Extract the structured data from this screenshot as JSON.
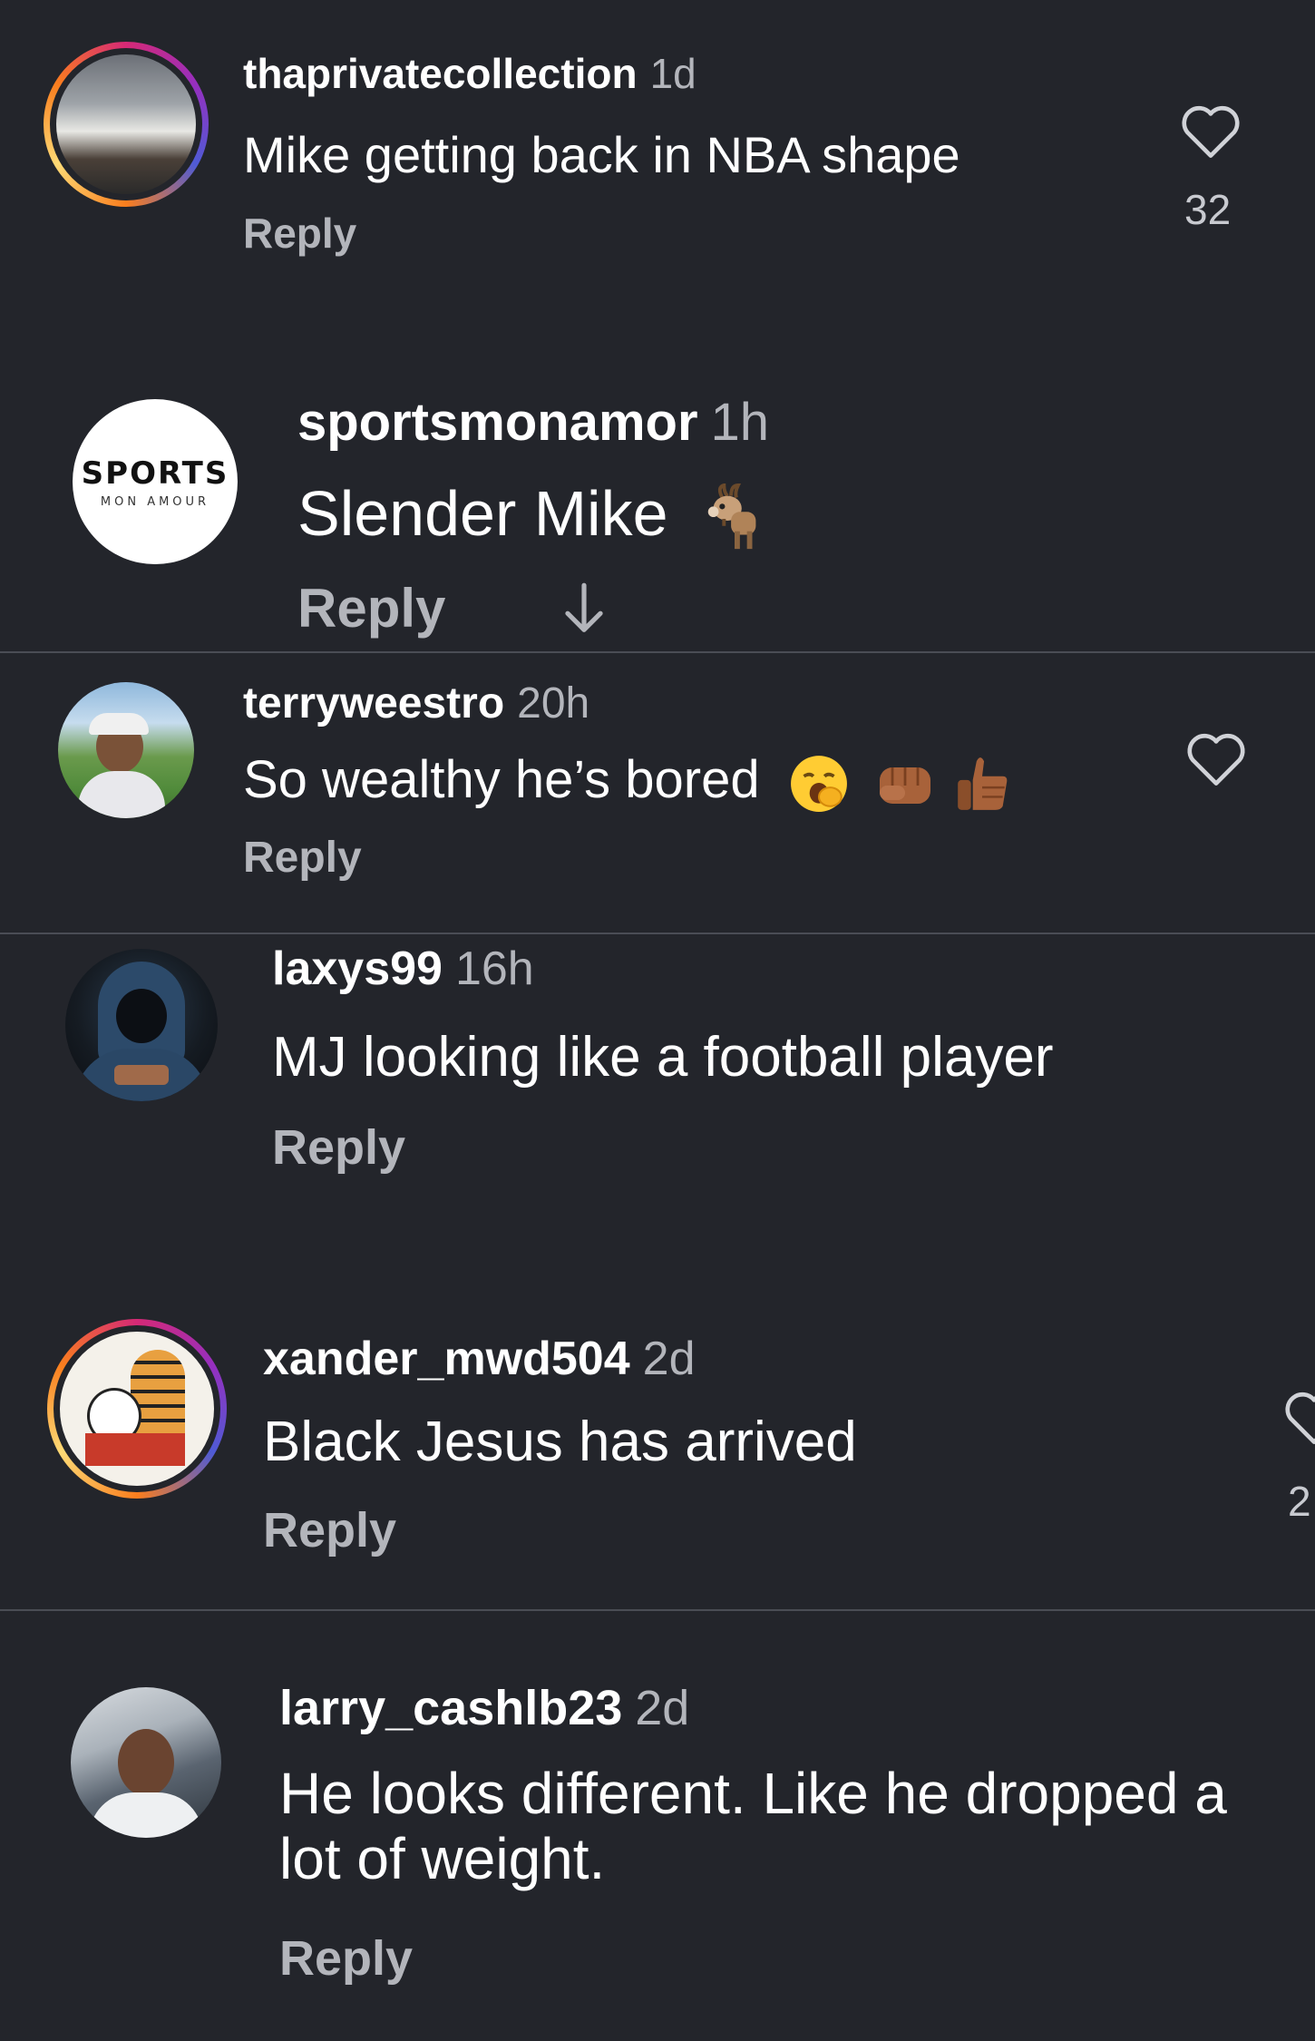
{
  "comments": [
    {
      "username": "thaprivatecollection",
      "time": "1d",
      "text": "Mike getting back in NBA shape",
      "reply": "Reply",
      "likes": "32",
      "avatar_icon": "avatar-photo-car"
    },
    {
      "username": "sportsmonamor",
      "time": "1h",
      "text": "Slender Mike",
      "reply": "Reply",
      "avatar_logo_big": "SPORTS",
      "avatar_logo_small": "MON AMOUR",
      "emoji": "goat-emoji",
      "extra_icon": "arrow-down-icon"
    },
    {
      "username": "terryweestro",
      "time": "20h",
      "text": "So wealthy he’s  bored",
      "reply": "Reply",
      "emojis": [
        "yawning-face-emoji",
        "fist-emoji",
        "thumbs-up-emoji"
      ]
    },
    {
      "username": "laxys99",
      "time": "16h",
      "text": "MJ looking like a football player",
      "reply": "Reply"
    },
    {
      "username": "xander_mwd504",
      "time": "2d",
      "text": "Black Jesus has arrived",
      "reply": "Reply",
      "likes": "2"
    },
    {
      "username": "larry_cashlb23",
      "time": "2d",
      "text_line1": "He looks different. Like he dropped a",
      "text_line2": "lot of weight.",
      "reply": "Reply"
    }
  ],
  "colors": {
    "background": "#23252b",
    "divider": "#4a4d55",
    "muted_text": "#b3b5bb"
  }
}
